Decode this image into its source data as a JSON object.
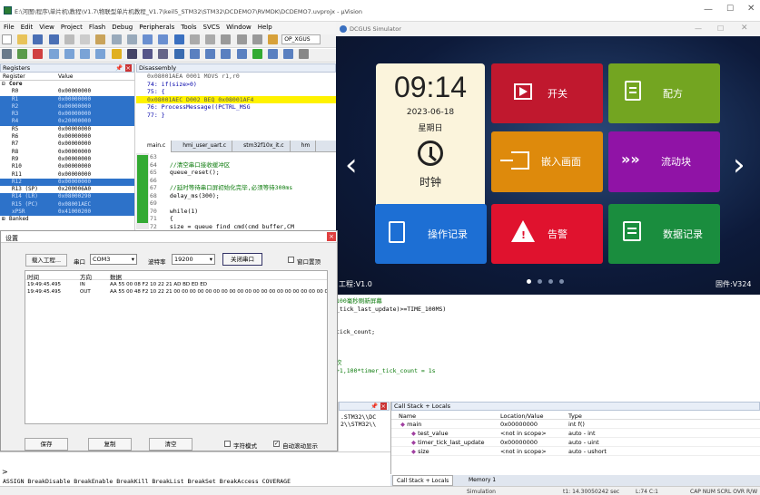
{
  "window": {
    "title": "E:\\河图\\程序\\单片机\\教程\\V1.7\\物联型单片机教程_V1.7\\keil5_STM32\\STM32\\DCDEMO7\\RVMDK\\DCDEMO7.uvprojx - µVision"
  },
  "menu": [
    "File",
    "Edit",
    "View",
    "Project",
    "Flash",
    "Debug",
    "Peripherals",
    "Tools",
    "SVCS",
    "Window",
    "Help"
  ],
  "toolbar": {
    "target": "OP_XGUS"
  },
  "registers": {
    "title": "Registers",
    "col_register": "Register",
    "col_value": "Value",
    "group": "Core",
    "rows": [
      {
        "n": "R0",
        "v": "0x00000000",
        "sel": false
      },
      {
        "n": "R1",
        "v": "0x00000000",
        "sel": true
      },
      {
        "n": "R2",
        "v": "0x00000000",
        "sel": true
      },
      {
        "n": "R3",
        "v": "0x00000000",
        "sel": true
      },
      {
        "n": "R4",
        "v": "0x20000000",
        "sel": true
      },
      {
        "n": "R5",
        "v": "0x00000000",
        "sel": false
      },
      {
        "n": "R6",
        "v": "0x00000000",
        "sel": false
      },
      {
        "n": "R7",
        "v": "0x00000000",
        "sel": false
      },
      {
        "n": "R8",
        "v": "0x00000000",
        "sel": false
      },
      {
        "n": "R9",
        "v": "0x00000000",
        "sel": false
      },
      {
        "n": "R10",
        "v": "0x00000000",
        "sel": false
      },
      {
        "n": "R11",
        "v": "0x00000000",
        "sel": false
      },
      {
        "n": "R12",
        "v": "0x00000000",
        "sel": true
      },
      {
        "n": "R13 (SP)",
        "v": "0x200006A0",
        "sel": false
      },
      {
        "n": "R14 (LR)",
        "v": "0x08000290",
        "sel": true
      },
      {
        "n": "R15 (PC)",
        "v": "0x08001AEC",
        "sel": true
      },
      {
        "n": "xPSR",
        "v": "0x41000200",
        "sel": true
      }
    ],
    "banked": "Banked"
  },
  "disassembly": {
    "title": "Disassembly",
    "lines": [
      {
        "t": "0x08001AEA 0001      MOVS      r1,r0",
        "hl": false
      },
      {
        "t": "    74:        if(size>0)",
        "hl": false
      },
      {
        "t": "    75:        {",
        "hl": false
      },
      {
        "t": "0x08001AEC D002      BEQ       0x08001AF4",
        "hl": true
      },
      {
        "t": "    76:            ProcessMessage((PCTRL_MSG",
        "hl": false
      },
      {
        "t": "    77:        }",
        "hl": false
      }
    ]
  },
  "editor": {
    "tabs": [
      "main.c",
      "hmi_user_uart.c",
      "stm32f10x_it.c",
      "hm"
    ],
    "lines": [
      {
        "no": "63",
        "t": ""
      },
      {
        "no": "64",
        "t": "    //清空串口接收缓冲区"
      },
      {
        "no": "65",
        "t": "    queue_reset();"
      },
      {
        "no": "66",
        "t": ""
      },
      {
        "no": "67",
        "t": "    //延时等待串口屏初始化完毕,必须等待300ms"
      },
      {
        "no": "68",
        "t": "    delay_ms(300);"
      },
      {
        "no": "69",
        "t": ""
      },
      {
        "no": "70",
        "t": "    while(1)"
      },
      {
        "no": "71",
        "t": "    {"
      },
      {
        "no": "72",
        "t": "        size = queue_find_cmd(cmd_buffer,CM"
      },
      {
        "no": "73",
        "t": ""
      }
    ],
    "lines_lower": [
      "100毫秒刷新屏幕",
      "_tick_last_update)>=TIME_100MS)",
      "",
      "",
      "tick_count;",
      "",
      "",
      "",
      "次",
      "+1,100*timer_tick_count = 1s"
    ]
  },
  "settings": {
    "title": "设置",
    "load_project": "载入工程...",
    "port_label": "串口",
    "port": "COM3",
    "baud_label": "波特率",
    "baud": "19200",
    "close_port": "关闭串口",
    "pin_window": "窗口置顶",
    "cols": [
      "时间",
      "方向",
      "数据"
    ],
    "rows": [
      {
        "time": "19:49:45.495",
        "dir": "IN",
        "data": "AA 55 00 08 F2 10 22 21 AD BD ED ED"
      },
      {
        "time": "19:49:45.495",
        "dir": "OUT",
        "data": "AA 55 00 48 F2 10 22 21 00 00 00 00 00 00 00 00 00 00 00 00 00 00 00 00 00 00 00 00 00 00 00 00 00 00 00 00 00..."
      }
    ],
    "save": "保存",
    "copy": "复制",
    "clear": "清空",
    "char_mode": "字符模式",
    "auto_scroll": "自动滚动显示"
  },
  "simulator": {
    "title": "DCGUS Simulator",
    "time": "09:14",
    "date": "2023-06-18",
    "weekday": "星期日",
    "clock_label": "时钟",
    "tiles": [
      {
        "label": "开关",
        "color": "#c0182e"
      },
      {
        "label": "配方",
        "color": "#73a521"
      },
      {
        "label": "嵌入画面",
        "color": "#de8a0c"
      },
      {
        "label": "流动块",
        "color": "#9013a6"
      },
      {
        "label": "操作记录",
        "color": "#1d6fd4"
      },
      {
        "label": "告警",
        "color": "#e0122e"
      },
      {
        "label": "数据记录",
        "color": "#1a8d3e"
      }
    ],
    "engineering_version": "工程:V1.0",
    "firmware_version": "固件:V324"
  },
  "callstack": {
    "title": "Call Stack + Locals",
    "cols": [
      "Name",
      "Location/Value",
      "Type"
    ],
    "rows": [
      {
        "name": "main",
        "val": "0x00000000",
        "type": "int f()"
      },
      {
        "name": "test_value",
        "val": "<not in scope>",
        "type": "auto - int"
      },
      {
        "name": "timer_tick_last_update",
        "val": "0x00000000",
        "type": "auto - uint"
      },
      {
        "name": "size",
        "val": "<not in scope>",
        "type": "auto - ushort"
      }
    ],
    "tab1": "Call Stack + Locals",
    "tab2": "Memory 1"
  },
  "left_lower": {
    "lines": [
      ".STM32\\\\DC",
      "2\\\\STM32\\\\"
    ]
  },
  "command": "ASSIGN BreakDisable BreakEnable BreakKill BreakList BreakSet BreakAccess COVERAGE",
  "status": {
    "mode": "Simulation",
    "time": "t1: 14.30050242 sec",
    "pos": "L:74 C:1",
    "flags": "CAP  NUM  SCRL  OVR  R/W"
  }
}
